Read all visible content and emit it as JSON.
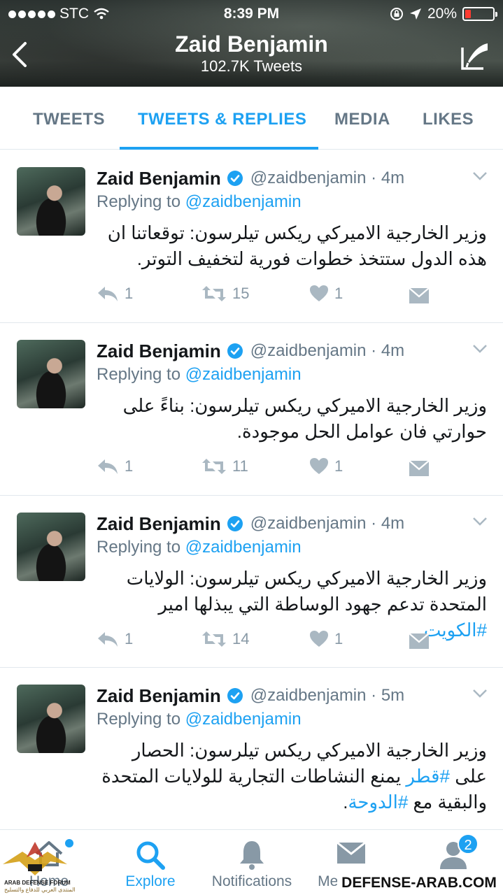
{
  "status_bar": {
    "carrier": "STC",
    "time": "8:39 PM",
    "battery": "20%",
    "battery_level": 0.2
  },
  "header": {
    "title": "Zaid Benjamin",
    "subtitle": "102.7K Tweets"
  },
  "tabs": [
    {
      "label": "TWEETS"
    },
    {
      "label": "TWEETS & REPLIES"
    },
    {
      "label": "MEDIA"
    },
    {
      "label": "LIKES"
    }
  ],
  "tweets": [
    {
      "name": "Zaid Benjamin",
      "handle_time": "@zaidbenjamin · 4m",
      "replying_prefix": "Replying to",
      "replying_to": "@zaidbenjamin",
      "text": "وزير الخارجية الاميركي ريكس تيلرسون: توقعاتنا ان هذه الدول ستتخذ خطوات فورية لتخفيف التوتر.",
      "replies": "1",
      "retweets": "15",
      "likes": "1"
    },
    {
      "name": "Zaid Benjamin",
      "handle_time": "@zaidbenjamin · 4m",
      "replying_prefix": "Replying to",
      "replying_to": "@zaidbenjamin",
      "text": "وزير الخارجية الاميركي ريكس تيلرسون: بناءً على حوارتي فان عوامل الحل موجودة.",
      "replies": "1",
      "retweets": "11",
      "likes": "1"
    },
    {
      "name": "Zaid Benjamin",
      "handle_time": "@zaidbenjamin · 4m",
      "replying_prefix": "Replying to",
      "replying_to": "@zaidbenjamin",
      "text_before": "وزير الخارجية الاميركي ريكس تيلرسون: الولايات المتحدة تدعم جهود الوساطة التي يبذلها امير ",
      "hashtag": "#الكويت",
      "text_after": ".",
      "replies": "1",
      "retweets": "14",
      "likes": "1"
    },
    {
      "name": "Zaid Benjamin",
      "handle_time": "@zaidbenjamin · 5m",
      "replying_prefix": "Replying to",
      "replying_to": "@zaidbenjamin",
      "text_before": "وزير الخارجية الاميركي ريكس تيلرسون: الحصار على ",
      "hashtag1": "#قطر",
      "text_middle": " يمنع النشاطات التجارية للولايات المتحدة والبقية مع ",
      "hashtag2": "#الدوحة",
      "text_after": "."
    }
  ],
  "bottom_nav": [
    {
      "label": "Home",
      "icon": "home-icon"
    },
    {
      "label": "Explore",
      "icon": "search-icon"
    },
    {
      "label": "Notifications",
      "icon": "bell-icon"
    },
    {
      "label": "Messages",
      "icon": "envelope-icon"
    },
    {
      "label": "Me",
      "icon": "person-icon"
    }
  ],
  "me_badge": "2",
  "watermark": {
    "site": "DEFENSE-ARAB.COM",
    "logo_line1": "ARAB DEFENSE FORUM",
    "logo_line2": "المنتدى العربي للدفاع والتسليح"
  },
  "colors": {
    "accent": "#1da1f2",
    "secondary_text": "#657786",
    "battery_low": "#ff3b30"
  }
}
